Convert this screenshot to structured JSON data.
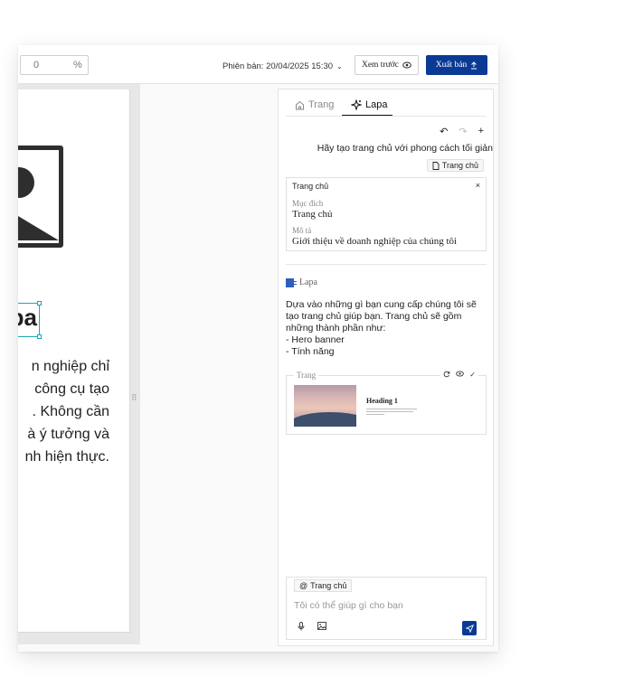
{
  "toolbar": {
    "zoom_value": "0",
    "zoom_unit": "%",
    "version_label": "Phiên bản: 20/04/2025 15:30",
    "preview_label": "Xem trước",
    "publish_label": "Xuất bản"
  },
  "canvas": {
    "heading_fragment": "pa",
    "body_lines": [
      "n nghiệp chỉ",
      "công cụ tạo",
      ". Không cần",
      "à ý tưởng và",
      "nh hiện thực."
    ]
  },
  "panel": {
    "tabs": [
      {
        "label": "Trang",
        "icon": "home-icon",
        "active": false
      },
      {
        "label": "Lapa",
        "icon": "sparkle-icon",
        "active": true
      }
    ],
    "user_prompt": "Hãy tạo trang chủ với phong cách tối giản",
    "user_prompt_chip": "Trang chủ",
    "context_card": {
      "title": "Trang chủ",
      "close_icon": "×",
      "purpose_label": "Mục đích",
      "purpose_value": "Trang chủ",
      "description_label": "Mô tả",
      "description_value": "Giới thiệu về doanh nghiệp của chúng tôi"
    },
    "assistant_name": "Lapa",
    "assistant_message": [
      "Dựa vào những gì bạn cung cấp chúng tôi sẽ",
      "tạo trang chủ giúp bạn. Trang chủ sẽ gồm",
      "những thành phần như:",
      "- Hero banner",
      "- Tính năng"
    ],
    "page_card": {
      "legend": "Trang",
      "thumbnail_heading": "Heading 1"
    },
    "composer": {
      "mention_chip": "Trang chủ",
      "placeholder": "Tôi có thể giúp gì cho bạn"
    }
  },
  "colors": {
    "accent": "#0b3a94",
    "selection": "#1aa7b8"
  }
}
